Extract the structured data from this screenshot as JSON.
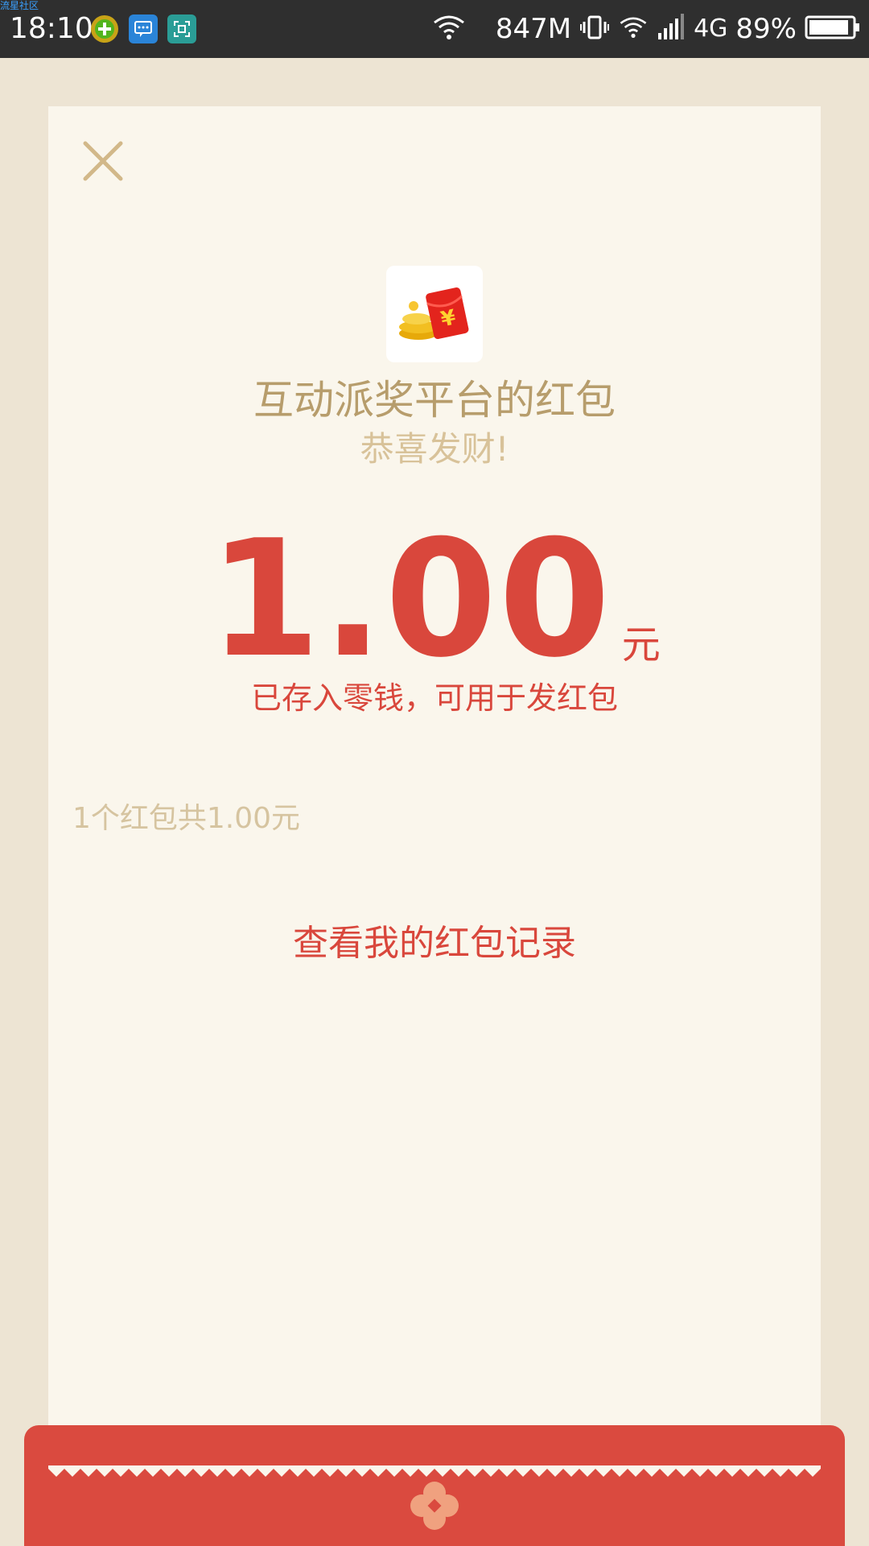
{
  "status_bar": {
    "watermark": "流星社区",
    "time": "18:10",
    "memory": "847M",
    "network_type": "4G",
    "battery": "89%",
    "icons": [
      "add-icon",
      "message-icon",
      "scan-icon",
      "wifi-icon",
      "vibrate-icon",
      "wifi-icon",
      "signal-icon",
      "battery-icon"
    ]
  },
  "card": {
    "close_icon": "close-icon",
    "app_icon": "red-envelope-coins-icon",
    "sender_name": "互动派奖平台的红包",
    "wish": "恭喜发财!",
    "amount": "1.00",
    "unit": "元",
    "deposit_note": "已存入零钱，可用于发红包",
    "summary": "1个红包共1.00元",
    "record_link": "查看我的红包记录"
  },
  "colors": {
    "accent_red": "#d9473c",
    "gold": "#b79d6c",
    "light_gold": "#d8c299",
    "card_bg": "#faf6ec",
    "page_bg": "#ede4d3"
  }
}
